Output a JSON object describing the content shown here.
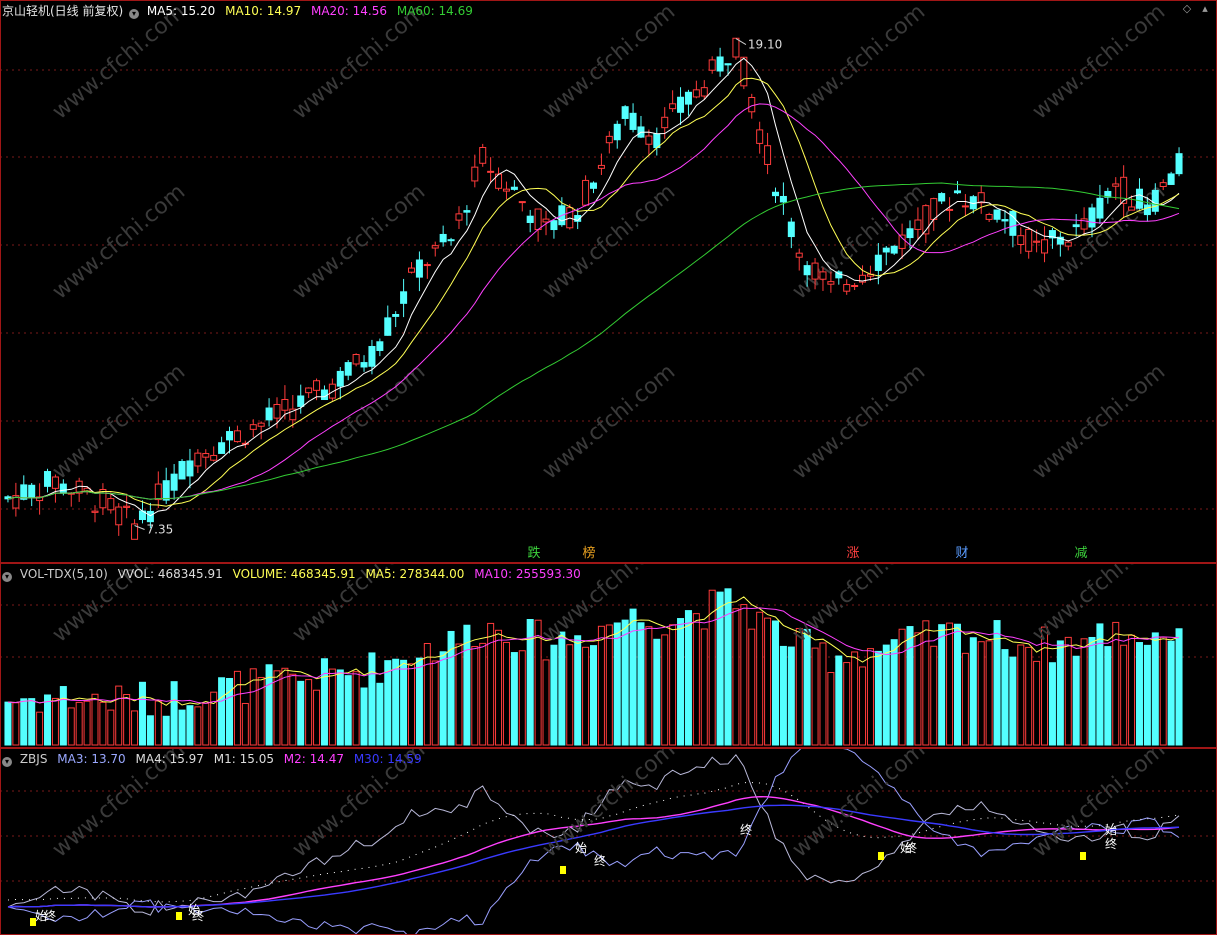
{
  "price_panel": {
    "title": "京山轻机(日线 前复权)",
    "collapse_icon": "chevron-down-icon",
    "ma5_label": "MA5: 15.20",
    "ma10_label": "MA10: 14.97",
    "ma20_label": "MA20: 14.56",
    "ma60_label": "MA60: 14.69",
    "high_label": "19.10",
    "low_label": "7.35",
    "signals": [
      {
        "text": "跌",
        "color": "#3cd23c"
      },
      {
        "text": "榜",
        "color": "#e8a020"
      },
      {
        "text": "涨",
        "color": "#ff4040"
      },
      {
        "text": "财",
        "color": "#5a9cff"
      },
      {
        "text": "减",
        "color": "#3cd23c"
      }
    ],
    "watermark": "www.cfchi.com",
    "colors": {
      "up": "#ff3b3b",
      "down": "#54ffff",
      "ma5": "#ffffff",
      "ma10": "#ffff55",
      "ma20": "#ff40ff",
      "ma60": "#33cc33"
    }
  },
  "volume_panel": {
    "name": "VOL-TDX(5,10)",
    "vvol": "VVOL: 468345.91",
    "volume": "VOLUME: 468345.91",
    "ma5": "MA5: 278344.00",
    "ma10": "MA10: 255593.30"
  },
  "zbjs_panel": {
    "name": "ZBJS",
    "ma3": "MA3: 13.70",
    "ma4": "MA4: 15.97",
    "m1": "M1: 15.05",
    "m2": "M2: 14.47",
    "m30": "M30: 14.59",
    "markers": [
      "始",
      "终",
      "始",
      "终",
      "始",
      "终",
      "终",
      "始",
      "终",
      "始",
      "终"
    ]
  },
  "chart_data": {
    "type": "candlestick",
    "title": "京山轻机(日线 前复权)",
    "visible_high": 19.1,
    "visible_low": 7.35,
    "last_ma": {
      "MA5": 15.2,
      "MA10": 14.97,
      "MA20": 14.56,
      "MA60": 14.69
    },
    "price_range": [
      7.0,
      19.5
    ],
    "volume_last": 468345.91,
    "volume_ma": {
      "MA5": 278344.0,
      "MA10": 255593.3
    },
    "indicator_last": {
      "MA3": 13.7,
      "MA4": 15.97,
      "M1": 15.05,
      "M2": 14.47,
      "M30": 14.59
    }
  }
}
